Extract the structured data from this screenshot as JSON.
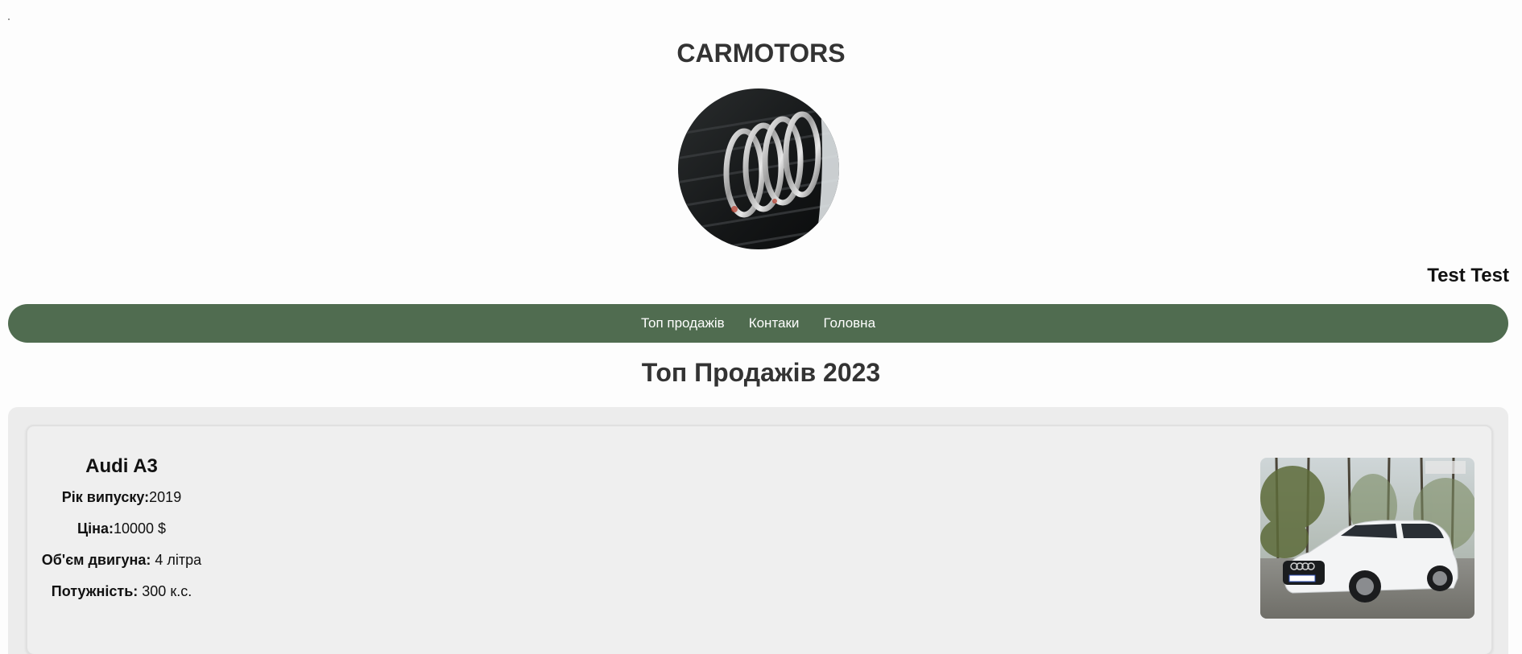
{
  "header": {
    "brand": "CARMOTORS",
    "logo_icon": "audi-rings-logo-icon",
    "user_name": "Test Test"
  },
  "nav": {
    "items": [
      {
        "label": "Топ продажів"
      },
      {
        "label": "Контаки"
      },
      {
        "label": "Головна"
      }
    ]
  },
  "main": {
    "title": "Топ Продажів 2023",
    "cars": [
      {
        "name": "Audi A3",
        "year_label": "Рік випуску:",
        "year_value": "2019",
        "price_label": "Ціна:",
        "price_value": "10000 $",
        "engine_label": "Об'єм двигуна:",
        "engine_value": " 4 літра",
        "power_label": "Потужність:",
        "power_value": " 300 к.с.",
        "photo_icon": "white-audi-suv-photo"
      }
    ]
  },
  "colors": {
    "nav_bg": "#506c50",
    "panel_bg": "#ececec",
    "text_dark": "#333333"
  }
}
